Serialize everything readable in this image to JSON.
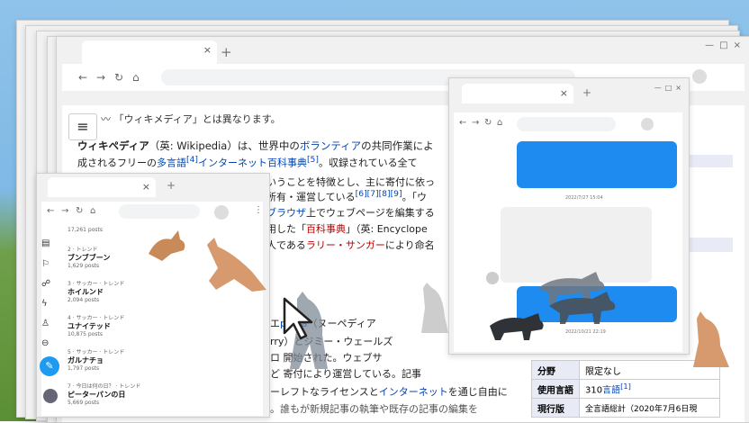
{
  "main_window": {
    "hatnote": "「ウィキメディア」とは異なります。",
    "menu_label": "≡",
    "paragraph_1": [
      {
        "t": "ウィキペディア",
        "k": "b"
      },
      {
        "t": "（英: Wikipedia）は、世界中の"
      },
      {
        "t": "ボランティア",
        "k": "l"
      },
      {
        "t": "の共同作業によ"
      }
    ],
    "paragraph_2": [
      {
        "t": "成されるフリーの"
      },
      {
        "t": "多言語",
        "k": "l"
      },
      {
        "t": "[4]",
        "k": "l"
      },
      {
        "t": "インターネット",
        "k": "l"
      },
      {
        "t": "百科事典",
        "k": "l"
      },
      {
        "t": "[5]",
        "k": "l"
      },
      {
        "t": "。収録されている全て"
      }
    ],
    "line_3": "いうことを特徴とし、主に寄付に依っ",
    "line_4_prefix": "所有・運営している",
    "line_4_refs": "[6][7][8][9]",
    "line_4_suffix": "。「ウ",
    "line_5_link": "ブラウザ",
    "line_5_text": "上でウェブページを編集する",
    "line_6_prefix": "用した「",
    "line_6_link": "百科事典",
    "line_6_suffix": "」（英: Encyclope",
    "line_7_prefix": "人である",
    "line_7_link": "ラリー・サンガー",
    "line_7_suffix": "により命名",
    "line_8_prefix": "エ",
    "line_8_link": "pedia",
    "line_8_suffix": "（ヌーペディア",
    "line_9_prefix": "rry",
    "line_9_suffix": "）とジミー・ウェールズ",
    "line_10": "ロ 開始された。ウェブサ",
    "line_11": "ど 寄付により運営している。記事",
    "line_12_prefix": "ーレフトなライセンスと",
    "line_12_link": "インターネット",
    "line_12_suffix": "を通じ自由に",
    "line_13": "。誰もが新規記事の執筆や既存の記事の編集を",
    "infobox": {
      "rows": [
        {
          "label": "分野",
          "value": "限定なし"
        },
        {
          "label": "使用言語",
          "value": "310",
          "value_link": "言語",
          "ref": "[1]"
        },
        {
          "label": "現行版",
          "value": "全言語総計（2020年7月6日現"
        }
      ]
    }
  },
  "chat_window": {
    "timestamp_1": "2022/7/27 15:04",
    "timestamp_2": "2022/10/21 22:19"
  },
  "trends_window": {
    "items": [
      {
        "category": "",
        "name": "",
        "posts": "17,261 posts"
      },
      {
        "category": "2 · トレンド",
        "name": "ブンブブーン",
        "posts": "1,629 posts"
      },
      {
        "category": "3 · サッカー · トレンド",
        "name": "ホイルンド",
        "posts": "2,094 posts"
      },
      {
        "category": "4 · サッカー · トレンド",
        "name": "ユナイテッド",
        "posts": "10,875 posts"
      },
      {
        "category": "5 · サッカー · トレンド",
        "name": "ガルナチョ",
        "posts": "1,797 posts"
      },
      {
        "category": "7 · 今日は何の日？ · トレンド",
        "name": "ピーターパンの日",
        "posts": "5,669 posts"
      }
    ]
  },
  "colors": {
    "accent_blue": "#1d8bf0",
    "link": "#0645ad",
    "redlink": "#ba0000"
  },
  "icons": {
    "back": "←",
    "forward": "→",
    "reload": "↻",
    "home": "⌂",
    "close": "×",
    "minimize": "—",
    "maximize": "□",
    "new_tab": "+",
    "more": "⋮"
  }
}
